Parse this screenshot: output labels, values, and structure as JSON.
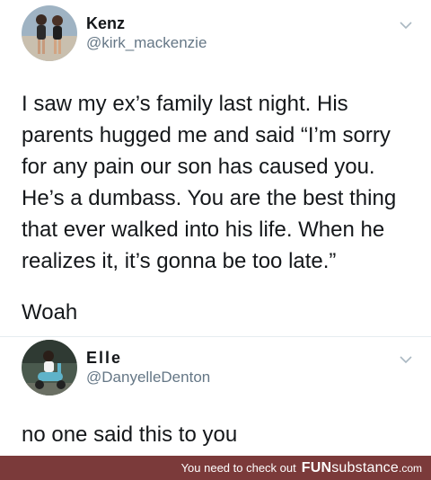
{
  "tweets": [
    {
      "display_name": "Kenz",
      "handle": "@kirk_mackenzie",
      "text_lines": [
        "I saw my ex’s family last night. His",
        "parents hugged me and said “I’m sorry",
        "for any pain our son has caused you.",
        "He’s a dumbass. You are the best thing",
        "that ever walked into his life. When he",
        "realizes it, it’s gonna be too late.”"
      ],
      "extra_line": "Woah",
      "avatar_icon": "profile-photo-two-people"
    },
    {
      "display_name": "Elle",
      "handle": "@DanyelleDenton",
      "text_lines": [
        "no one said this to you"
      ],
      "avatar_icon": "profile-photo-person-on-scooter"
    }
  ],
  "footer": {
    "text": "You need to check out",
    "brand_bold": "FUN",
    "brand_thin": "substance",
    "brand_suffix": ".com",
    "background": "#7b3a3a"
  },
  "colors": {
    "text": "#14171a",
    "secondary": "#657786",
    "divider": "#e6ecf0"
  }
}
